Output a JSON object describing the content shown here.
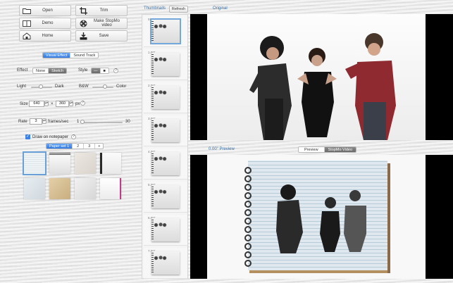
{
  "actions": [
    {
      "id": "open",
      "label": "Open",
      "icon": "folder-icon"
    },
    {
      "id": "trim",
      "label": "Trim",
      "icon": "crop-icon"
    },
    {
      "id": "demo",
      "label": "Demo",
      "icon": "book-icon"
    },
    {
      "id": "make",
      "label": "Make StopMo video",
      "icon": "film-reel-icon"
    },
    {
      "id": "home",
      "label": "Home",
      "icon": "house-icon"
    },
    {
      "id": "save",
      "label": "Save",
      "icon": "download-icon"
    }
  ],
  "tabs": {
    "visual": "Visual Effect",
    "sound": "Sound Track"
  },
  "effect": {
    "label": "Effect",
    "none": "None",
    "sketch": "Sketch"
  },
  "style": {
    "label": "Style",
    "options": [
      "—",
      "■"
    ]
  },
  "light": {
    "left": "Light",
    "right": "Dark",
    "value": 0.45
  },
  "bw": {
    "left": "B&W",
    "right": "Color",
    "value": 0.6
  },
  "size": {
    "label": "Size",
    "width": "640",
    "x": "×",
    "height": "360",
    "unit": "px"
  },
  "rate": {
    "label": "Rate",
    "value": "3",
    "unit": "frames/sec",
    "min": "1",
    "max": "30"
  },
  "notepaper": {
    "label": "Draw on notepaper",
    "checked": true
  },
  "paper_sets": {
    "items": [
      "Paper set 1",
      "2",
      "3",
      "+"
    ]
  },
  "thumbnails": {
    "title": "Thumbnails",
    "refresh": "Refresh",
    "items": [
      "0.00\"",
      "1.00\"",
      "2.00\"",
      "3.00\"",
      "4.00\"",
      "5.00\"",
      "6.00\"",
      "7.00\""
    ]
  },
  "original": {
    "label": "Original"
  },
  "preview": {
    "time": "0.00\" Preview",
    "tabs": [
      "Preview",
      "StopMo Video"
    ]
  },
  "colors": {
    "accent": "#3a82e8",
    "selected_border": "#74a8dc"
  }
}
